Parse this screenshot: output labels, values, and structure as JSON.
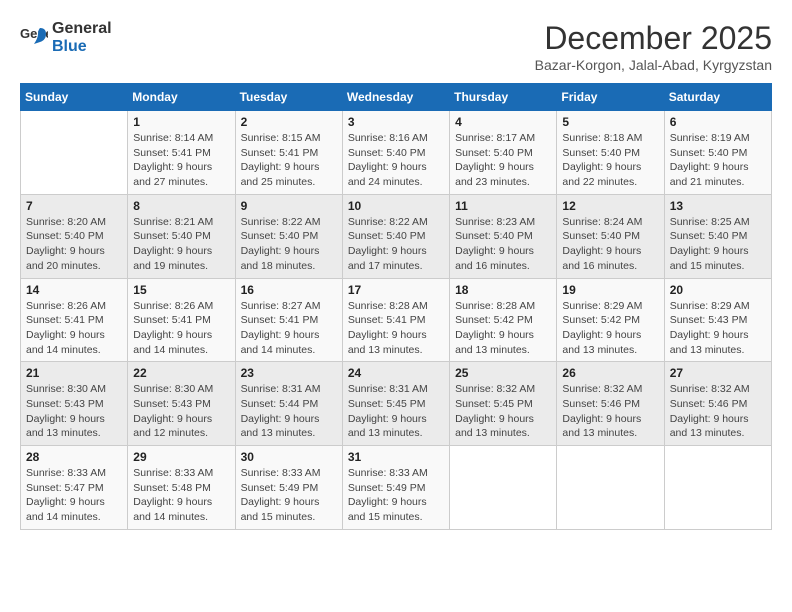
{
  "logo": {
    "line1": "General",
    "line2": "Blue"
  },
  "title": "December 2025",
  "location": "Bazar-Korgon, Jalal-Abad, Kyrgyzstan",
  "weekdays": [
    "Sunday",
    "Monday",
    "Tuesday",
    "Wednesday",
    "Thursday",
    "Friday",
    "Saturday"
  ],
  "weeks": [
    [
      {
        "day": "",
        "info": ""
      },
      {
        "day": "1",
        "info": "Sunrise: 8:14 AM\nSunset: 5:41 PM\nDaylight: 9 hours\nand 27 minutes."
      },
      {
        "day": "2",
        "info": "Sunrise: 8:15 AM\nSunset: 5:41 PM\nDaylight: 9 hours\nand 25 minutes."
      },
      {
        "day": "3",
        "info": "Sunrise: 8:16 AM\nSunset: 5:40 PM\nDaylight: 9 hours\nand 24 minutes."
      },
      {
        "day": "4",
        "info": "Sunrise: 8:17 AM\nSunset: 5:40 PM\nDaylight: 9 hours\nand 23 minutes."
      },
      {
        "day": "5",
        "info": "Sunrise: 8:18 AM\nSunset: 5:40 PM\nDaylight: 9 hours\nand 22 minutes."
      },
      {
        "day": "6",
        "info": "Sunrise: 8:19 AM\nSunset: 5:40 PM\nDaylight: 9 hours\nand 21 minutes."
      }
    ],
    [
      {
        "day": "7",
        "info": "Sunrise: 8:20 AM\nSunset: 5:40 PM\nDaylight: 9 hours\nand 20 minutes."
      },
      {
        "day": "8",
        "info": "Sunrise: 8:21 AM\nSunset: 5:40 PM\nDaylight: 9 hours\nand 19 minutes."
      },
      {
        "day": "9",
        "info": "Sunrise: 8:22 AM\nSunset: 5:40 PM\nDaylight: 9 hours\nand 18 minutes."
      },
      {
        "day": "10",
        "info": "Sunrise: 8:22 AM\nSunset: 5:40 PM\nDaylight: 9 hours\nand 17 minutes."
      },
      {
        "day": "11",
        "info": "Sunrise: 8:23 AM\nSunset: 5:40 PM\nDaylight: 9 hours\nand 16 minutes."
      },
      {
        "day": "12",
        "info": "Sunrise: 8:24 AM\nSunset: 5:40 PM\nDaylight: 9 hours\nand 16 minutes."
      },
      {
        "day": "13",
        "info": "Sunrise: 8:25 AM\nSunset: 5:40 PM\nDaylight: 9 hours\nand 15 minutes."
      }
    ],
    [
      {
        "day": "14",
        "info": "Sunrise: 8:26 AM\nSunset: 5:41 PM\nDaylight: 9 hours\nand 14 minutes."
      },
      {
        "day": "15",
        "info": "Sunrise: 8:26 AM\nSunset: 5:41 PM\nDaylight: 9 hours\nand 14 minutes."
      },
      {
        "day": "16",
        "info": "Sunrise: 8:27 AM\nSunset: 5:41 PM\nDaylight: 9 hours\nand 14 minutes."
      },
      {
        "day": "17",
        "info": "Sunrise: 8:28 AM\nSunset: 5:41 PM\nDaylight: 9 hours\nand 13 minutes."
      },
      {
        "day": "18",
        "info": "Sunrise: 8:28 AM\nSunset: 5:42 PM\nDaylight: 9 hours\nand 13 minutes."
      },
      {
        "day": "19",
        "info": "Sunrise: 8:29 AM\nSunset: 5:42 PM\nDaylight: 9 hours\nand 13 minutes."
      },
      {
        "day": "20",
        "info": "Sunrise: 8:29 AM\nSunset: 5:43 PM\nDaylight: 9 hours\nand 13 minutes."
      }
    ],
    [
      {
        "day": "21",
        "info": "Sunrise: 8:30 AM\nSunset: 5:43 PM\nDaylight: 9 hours\nand 13 minutes."
      },
      {
        "day": "22",
        "info": "Sunrise: 8:30 AM\nSunset: 5:43 PM\nDaylight: 9 hours\nand 12 minutes."
      },
      {
        "day": "23",
        "info": "Sunrise: 8:31 AM\nSunset: 5:44 PM\nDaylight: 9 hours\nand 13 minutes."
      },
      {
        "day": "24",
        "info": "Sunrise: 8:31 AM\nSunset: 5:45 PM\nDaylight: 9 hours\nand 13 minutes."
      },
      {
        "day": "25",
        "info": "Sunrise: 8:32 AM\nSunset: 5:45 PM\nDaylight: 9 hours\nand 13 minutes."
      },
      {
        "day": "26",
        "info": "Sunrise: 8:32 AM\nSunset: 5:46 PM\nDaylight: 9 hours\nand 13 minutes."
      },
      {
        "day": "27",
        "info": "Sunrise: 8:32 AM\nSunset: 5:46 PM\nDaylight: 9 hours\nand 13 minutes."
      }
    ],
    [
      {
        "day": "28",
        "info": "Sunrise: 8:33 AM\nSunset: 5:47 PM\nDaylight: 9 hours\nand 14 minutes."
      },
      {
        "day": "29",
        "info": "Sunrise: 8:33 AM\nSunset: 5:48 PM\nDaylight: 9 hours\nand 14 minutes."
      },
      {
        "day": "30",
        "info": "Sunrise: 8:33 AM\nSunset: 5:49 PM\nDaylight: 9 hours\nand 15 minutes."
      },
      {
        "day": "31",
        "info": "Sunrise: 8:33 AM\nSunset: 5:49 PM\nDaylight: 9 hours\nand 15 minutes."
      },
      {
        "day": "",
        "info": ""
      },
      {
        "day": "",
        "info": ""
      },
      {
        "day": "",
        "info": ""
      }
    ]
  ]
}
